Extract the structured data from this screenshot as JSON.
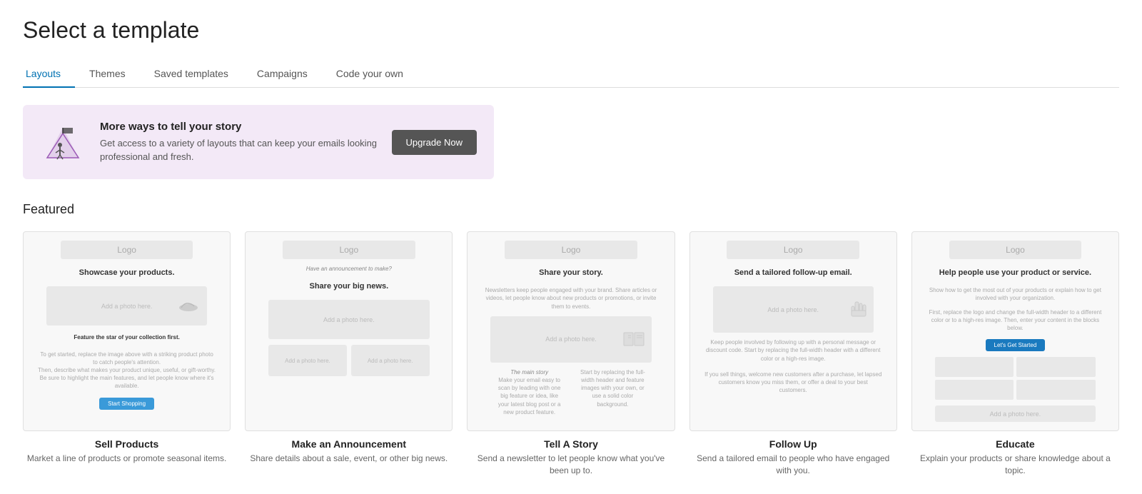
{
  "page": {
    "title": "Select a template"
  },
  "tabs": [
    {
      "id": "layouts",
      "label": "Layouts",
      "active": true
    },
    {
      "id": "themes",
      "label": "Themes",
      "active": false
    },
    {
      "id": "saved",
      "label": "Saved templates",
      "active": false
    },
    {
      "id": "campaigns",
      "label": "Campaigns",
      "active": false
    },
    {
      "id": "code",
      "label": "Code your own",
      "active": false
    }
  ],
  "promo": {
    "heading": "More ways to tell your story",
    "description": "Get access to a variety of layouts that can keep your emails looking professional and fresh.",
    "button_label": "Upgrade Now"
  },
  "featured": {
    "section_title": "Featured",
    "templates": [
      {
        "id": "sell-products",
        "name": "Sell Products",
        "description": "Market a line of products or promote seasonal items.",
        "preview_heading": "Showcase your products.",
        "preview_subtext": "Feature the star of your collection first.",
        "preview_body": "To get started, replace the image above with a striking product photo to catch people's attention. Then, describe what makes your product unique, useful, or gift-worthy. Be sure to highlight the main features, and let people know where it's available.",
        "button_label": "Start Shopping"
      },
      {
        "id": "make-announcement",
        "name": "Make an Announcement",
        "description": "Share details about a sale, event, or other big news.",
        "preview_heading": "Share your big news.",
        "preview_subtext": "Have an announcement to make?",
        "preview_body": ""
      },
      {
        "id": "tell-story",
        "name": "Tell A Story",
        "description": "Send a newsletter to let people know what you've been up to.",
        "preview_heading": "Share your story.",
        "preview_subtext": "Newsletters keep people engaged with your brand. Share articles or videos, let people know about new products or promotions, or invite them to events.",
        "preview_body": "The main story"
      },
      {
        "id": "follow-up",
        "name": "Follow Up",
        "description": "Send a tailored email to people who have engaged with you.",
        "preview_heading": "Send a tailored follow-up email.",
        "preview_subtext": "",
        "preview_body": "Keep people involved by following up with a personal message or discount code. Start by replacing the full-width header with a different color or a high-res image."
      },
      {
        "id": "educate",
        "name": "Educate",
        "description": "Explain your products or share knowledge about a topic.",
        "preview_heading": "Help people use your product or service.",
        "preview_subtext": "Show how to get the most out of your products or explain how to get involved with your organization.",
        "preview_body": "First, replace the logo and change the full-width header to a different color or to a high-res image. Then, enter your content in the blocks below.",
        "button_label": "Let's Get Started"
      }
    ]
  }
}
